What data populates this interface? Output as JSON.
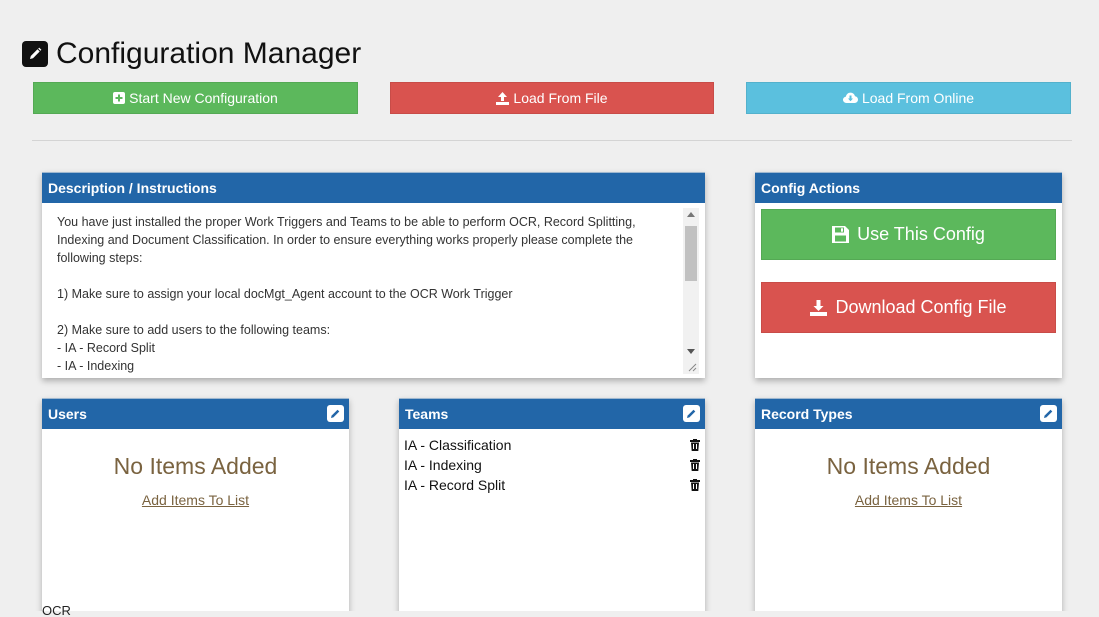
{
  "page": {
    "title": "Configuration Manager"
  },
  "top_buttons": {
    "start_new": "Start New Configuration",
    "load_file": "Load From File",
    "load_online": "Load From Online"
  },
  "description": {
    "header": "Description / Instructions",
    "text": "You have just installed the proper Work Triggers and Teams to be able to perform OCR, Record Splitting, Indexing and Document Classification. In order to ensure everything works properly please complete the following steps:\n\n1) Make sure to assign your local docMgt_Agent account to the OCR Work Trigger\n\n2) Make sure to add users to the following teams:\n- IA - Record Split\n- IA - Indexing"
  },
  "config_actions": {
    "header": "Config Actions",
    "use_config": "Use This Config",
    "download": "Download Config File"
  },
  "users": {
    "header": "Users",
    "empty": "No Items Added",
    "add_link": "Add Items To List"
  },
  "teams": {
    "header": "Teams",
    "items": [
      "IA - Classification",
      "IA - Indexing",
      "IA - Record Split"
    ]
  },
  "record_types": {
    "header": "Record Types",
    "empty": "No Items Added",
    "add_link": "Add Items To List"
  },
  "below_fold": {
    "label": "OCR"
  },
  "colors": {
    "header_blue": "#2266a8",
    "success": "#5cb85c",
    "danger": "#d9534f",
    "info": "#5bc0de",
    "empty_text": "#7a6340"
  }
}
